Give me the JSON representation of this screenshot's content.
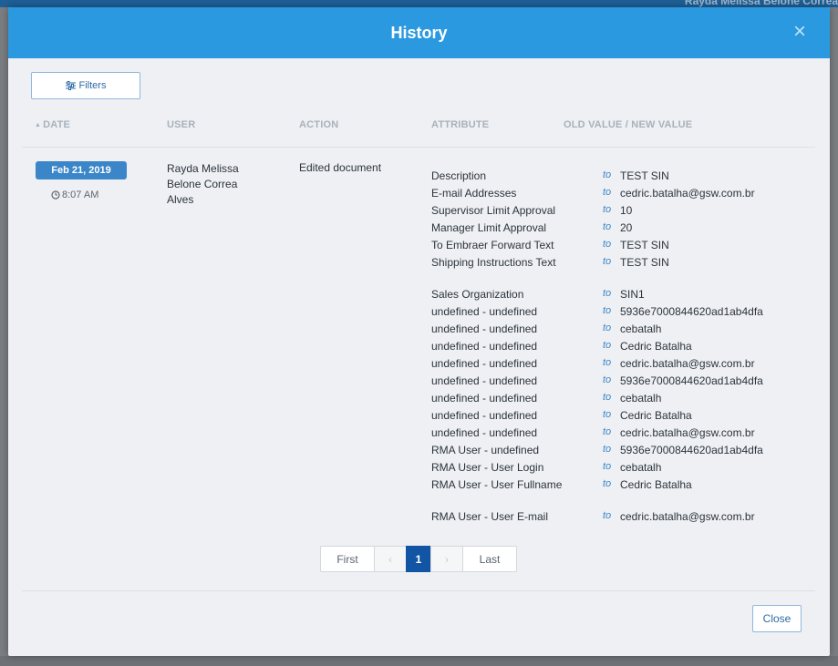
{
  "background": {
    "user_name": "Rayda Melissa Belone Correa"
  },
  "modal": {
    "title": "History",
    "filters_label": "Filters",
    "close_label": "Close"
  },
  "table": {
    "headers": {
      "date": "DATE",
      "user": "USER",
      "action": "ACTION",
      "attribute": "ATTRIBUTE",
      "values": "OLD VALUE / NEW VALUE"
    },
    "entry": {
      "date": "Feb 21, 2019",
      "time": "8:07 AM",
      "user_lines": [
        "Rayda Melissa",
        "Belone Correa",
        "Alves"
      ],
      "action": "Edited document",
      "connector": "to",
      "changes": [
        {
          "attribute": "Description",
          "new_value": "TEST SIN"
        },
        {
          "attribute": "E-mail Addresses",
          "new_value": "cedric.batalha@gsw.com.br"
        },
        {
          "attribute": "Supervisor Limit Approval",
          "new_value": "10"
        },
        {
          "attribute": "Manager Limit Approval",
          "new_value": "20"
        },
        {
          "attribute": "To Embraer Forward Text",
          "new_value": "TEST SIN"
        },
        {
          "attribute": "Shipping Instructions Text",
          "new_value": "TEST SIN"
        },
        {
          "attribute": "Sales Organization",
          "new_value": "SIN1"
        },
        {
          "attribute": "undefined - undefined",
          "new_value": "5936e7000844620ad1ab4dfa"
        },
        {
          "attribute": "undefined - undefined",
          "new_value": "cebatalh"
        },
        {
          "attribute": "undefined - undefined",
          "new_value": "Cedric Batalha"
        },
        {
          "attribute": "undefined - undefined",
          "new_value": "cedric.batalha@gsw.com.br"
        },
        {
          "attribute": "undefined - undefined",
          "new_value": "5936e7000844620ad1ab4dfa"
        },
        {
          "attribute": "undefined - undefined",
          "new_value": "cebatalh"
        },
        {
          "attribute": "undefined - undefined",
          "new_value": "Cedric Batalha"
        },
        {
          "attribute": "undefined - undefined",
          "new_value": "cedric.batalha@gsw.com.br"
        },
        {
          "attribute": "RMA User - undefined",
          "new_value": "5936e7000844620ad1ab4dfa"
        },
        {
          "attribute": "RMA User - User Login",
          "new_value": "cebatalh"
        },
        {
          "attribute": "RMA User - User Fullname",
          "new_value": "Cedric Batalha"
        },
        {
          "attribute": "RMA User - User E-mail",
          "new_value": "cedric.batalha@gsw.com.br"
        }
      ]
    }
  },
  "pagination": {
    "first": "First",
    "prev": "‹",
    "current": "1",
    "next": "›",
    "last": "Last"
  },
  "colors": {
    "header": "#2a99e0",
    "badge": "#3a86c8",
    "active_page": "#1255a5"
  }
}
